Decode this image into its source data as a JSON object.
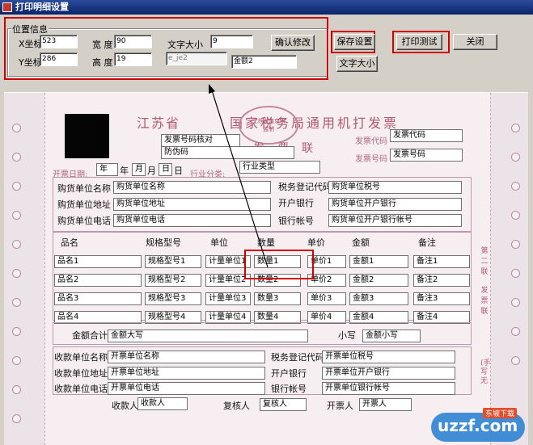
{
  "window": {
    "title": "打印明细设置"
  },
  "position_group": {
    "title": "位置信息",
    "x_label": "X坐标",
    "x_value": "523",
    "y_label": "Y坐标",
    "y_value": "286",
    "width_label": "宽 度",
    "width_value": "90",
    "height_label": "高 度",
    "height_value": "19",
    "font_label": "文字大小",
    "font_value": "9",
    "field_id_value": "e_je2",
    "field_name_value": "金额2",
    "confirm_label": "确认修改"
  },
  "toolbar": {
    "save_label": "保存设置",
    "print_test_label": "打印测试",
    "close_label": "关闭",
    "font_size_label": "文字大小"
  },
  "invoice": {
    "province": "江苏省",
    "title_rest": "国家税务局通用机打发票",
    "stamp_line1": "江苏省南京市",
    "stamp_line2": "监制",
    "invoice_type_mark": "发票联",
    "verify_code": "发票号码核对",
    "anti_fake_code": "防伪码",
    "invoice_code_label": "发票代码",
    "invoice_code_value": "发票代码",
    "invoice_number_label": "发票号码",
    "invoice_number_value": "发票号码",
    "date_label": "开票日期:",
    "year_val": "年",
    "year_char": "年",
    "month_val": "月",
    "month_char": "月",
    "day_val": "日",
    "day_char": "日",
    "industry_label": "行业分类:",
    "industry_value": "行业类型",
    "buyer": {
      "name_label": "购货单位名称",
      "name_value": "购货单位名称",
      "address_label": "购货单位地址",
      "address_value": "购货单位地址",
      "phone_label": "购货单位电话",
      "phone_value": "购货单位电话",
      "tax_label": "税务登记代码",
      "tax_value": "购货单位税号",
      "bank_label": "开户银行",
      "bank_value": "购货单位开户银行",
      "account_label": "银行帐号",
      "account_value": "购货单位开户银行帐号"
    },
    "columns": [
      "品名",
      "规格型号",
      "单位",
      "数量",
      "单价",
      "金额",
      "备注"
    ],
    "rows": [
      [
        "品名1",
        "规格型号1",
        "计量单位1",
        "数量1",
        "单价1",
        "金额1",
        "备注1"
      ],
      [
        "品名2",
        "规格型号2",
        "计量单位2",
        "数量2",
        "单价2",
        "金额2",
        "备注2"
      ],
      [
        "品名3",
        "规格型号3",
        "计量单位3",
        "数量3",
        "单价3",
        "金额3",
        "备注3"
      ],
      [
        "品名4",
        "规格型号4",
        "计量单位4",
        "数量4",
        "单价4",
        "金额4",
        "备注4"
      ]
    ],
    "total_label": "金额合计",
    "total_upper_value": "金额大写",
    "small_label": "小写",
    "total_small_value": "金额小写",
    "seller": {
      "name_label": "收款单位名称",
      "name_value": "开票单位名称",
      "address_label": "收款单位地址",
      "address_value": "开票单位地址",
      "phone_label": "收款单位电话",
      "phone_value": "开票单位电话",
      "tax_label": "税务登记代码",
      "tax_value": "开票单位税号",
      "bank_label": "开户银行",
      "bank_value": "开票单位开户银行",
      "account_label": "银行帐号",
      "account_value": "开票单位银行帐号"
    },
    "payee_label": "收款人",
    "payee_value": "收款人",
    "reviewer_label": "复核人",
    "reviewer_value": "复核人",
    "drawer_label": "开票人",
    "drawer_value": "开票人",
    "side_right": [
      "第",
      "二",
      "联",
      "",
      "发",
      "票",
      "联"
    ],
    "side_right_extra": "(手写无",
    "watermark": "uzzf.com",
    "watermark_sub": "东坡下载"
  },
  "colors": {
    "title_bar": "#0a246a",
    "highlight": "#d00000",
    "invoice_red": "#b05a72"
  }
}
